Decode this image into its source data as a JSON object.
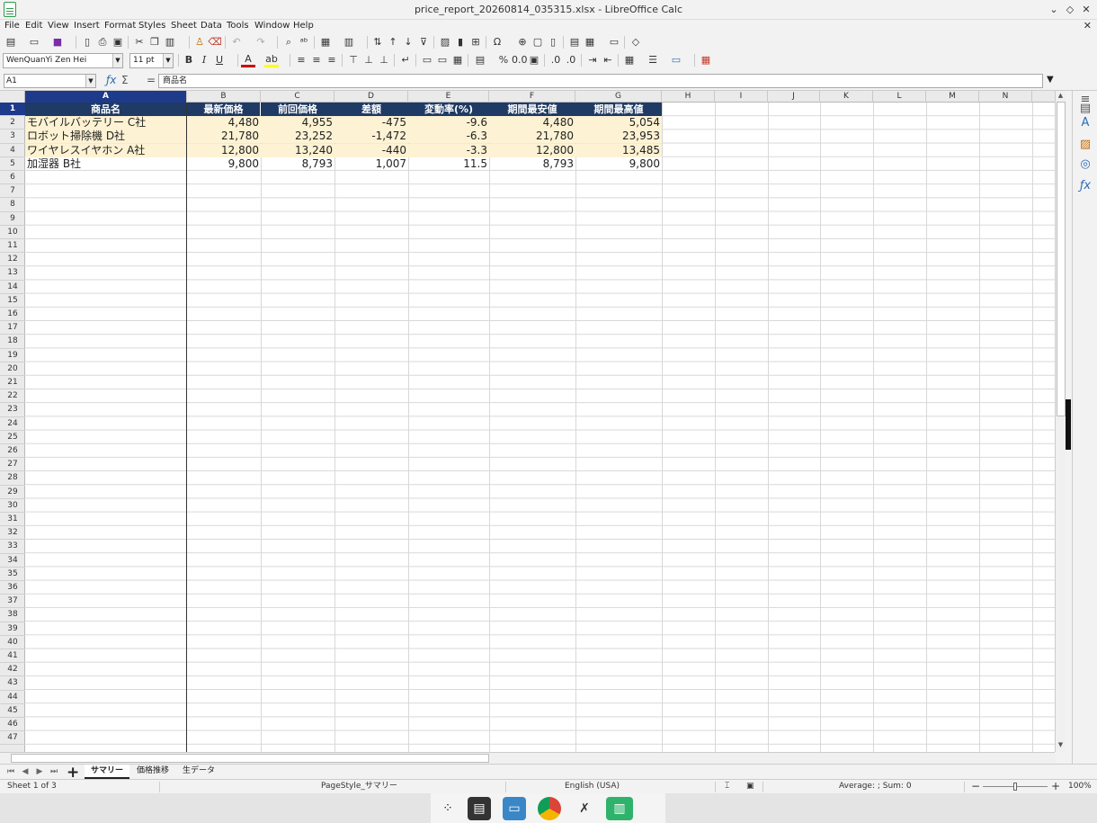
{
  "window": {
    "title": "price_report_20260814_035315.xlsx - LibreOffice Calc"
  },
  "menu": [
    "File",
    "Edit",
    "View",
    "Insert",
    "Format",
    "Styles",
    "Sheet",
    "Data",
    "Tools",
    "Window",
    "Help"
  ],
  "format_toolbar": {
    "font_name": "WenQuanYi Zen Hei",
    "font_size": "11 pt"
  },
  "formula_bar": {
    "cell_ref": "A1",
    "content": "商品名"
  },
  "columns": [
    "A",
    "B",
    "C",
    "D",
    "E",
    "F",
    "G",
    "H",
    "I",
    "J",
    "K",
    "L",
    "M",
    "N"
  ],
  "row_count": 47,
  "sheet": {
    "headers": [
      "商品名",
      "最新価格",
      "前回価格",
      "差額",
      "変動率(%)",
      "期間最安値",
      "期間最高値"
    ],
    "rows": [
      [
        "モバイルバッテリー C社",
        "4,480",
        "4,955",
        "-475",
        "-9.6",
        "4,480",
        "5,054"
      ],
      [
        "ロボット掃除機 D社",
        "21,780",
        "23,252",
        "-1,472",
        "-6.3",
        "21,780",
        "23,953"
      ],
      [
        "ワイヤレスイヤホン A社",
        "12,800",
        "13,240",
        "-440",
        "-3.3",
        "12,800",
        "13,485"
      ],
      [
        "加湿器 B社",
        "9,800",
        "8,793",
        "1,007",
        "11.5",
        "8,793",
        "9,800"
      ]
    ]
  },
  "tabs": [
    "サマリー",
    "価格推移",
    "生データ"
  ],
  "active_tab": "サマリー",
  "status": {
    "sheet": "Sheet 1 of 3",
    "page_style": "PageStyle_サマリー",
    "language": "English (USA)",
    "summary": "Average: ; Sum: 0",
    "zoom": "100%"
  },
  "colors": {
    "header_fill": "#1f3a64",
    "highlight_fill": "#fdf2d3",
    "selection": "#1e3a8a"
  }
}
